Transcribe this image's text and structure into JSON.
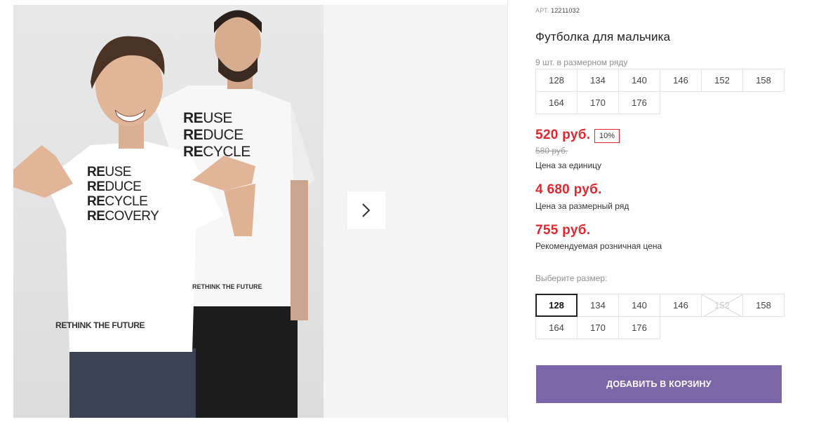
{
  "product": {
    "article_label": "АРТ.",
    "article_value": "12211032",
    "title": "Футболка для мальчика",
    "image_alt": "Фото товара: мальчик и мужчина в белых футболках с принтом REUSE REDUCE RECYCLE RECOVERY",
    "print_lines": [
      "RE",
      "USE",
      "RE",
      "DUCE",
      "RE",
      "CYCLE",
      "RE",
      "COVERY"
    ],
    "print_bottom": "RETHINK THE FUTURE",
    "range_label": "9 шт. в размерном ряду",
    "range_sizes": [
      "128",
      "134",
      "140",
      "146",
      "152",
      "158",
      "164",
      "170",
      "176"
    ]
  },
  "prices": {
    "discount_price": "520 руб.",
    "discount_badge": "10%",
    "old_price": "580 руб.",
    "unit_note": "Цена за единицу",
    "range_price": "4 680 руб.",
    "range_note": "Цена за размерный ряд",
    "retail_price": "755 руб.",
    "retail_note": "Рекомендуемая розничная цена"
  },
  "size_select": {
    "label": "Выберите размер:",
    "sizes": [
      "128",
      "134",
      "140",
      "146",
      "152",
      "158",
      "164",
      "170",
      "176"
    ],
    "selected": "128",
    "unavailable": [
      "152"
    ]
  },
  "cart": {
    "button_label": "ДОБАВИТЬ В КОРЗИНУ"
  },
  "icons": {
    "next": "chevron-right-icon"
  },
  "colors": {
    "accent_price": "#e2262e",
    "cart_button": "#7b66a7"
  }
}
